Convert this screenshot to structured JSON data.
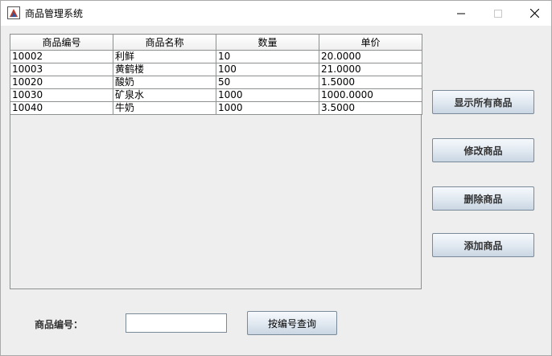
{
  "window": {
    "title": "商品管理系统"
  },
  "table": {
    "headers": [
      "商品编号",
      "商品名称",
      "数量",
      "单价"
    ],
    "rows": [
      [
        "10002",
        "利鲜",
        "10",
        "20.0000"
      ],
      [
        "10003",
        "黄鹤楼",
        "100",
        "21.0000"
      ],
      [
        "10020",
        "酸奶",
        "50",
        "1.5000"
      ],
      [
        "10030",
        "矿泉水",
        "1000",
        "1000.0000"
      ],
      [
        "10040",
        "牛奶",
        "1000",
        "3.5000"
      ]
    ]
  },
  "side_buttons": {
    "show_all": "显示所有商品",
    "modify": "修改商品",
    "delete": "删除商品",
    "add": "添加商品"
  },
  "query": {
    "label": "商品编号：",
    "input_value": "",
    "button": "按编号查询"
  }
}
